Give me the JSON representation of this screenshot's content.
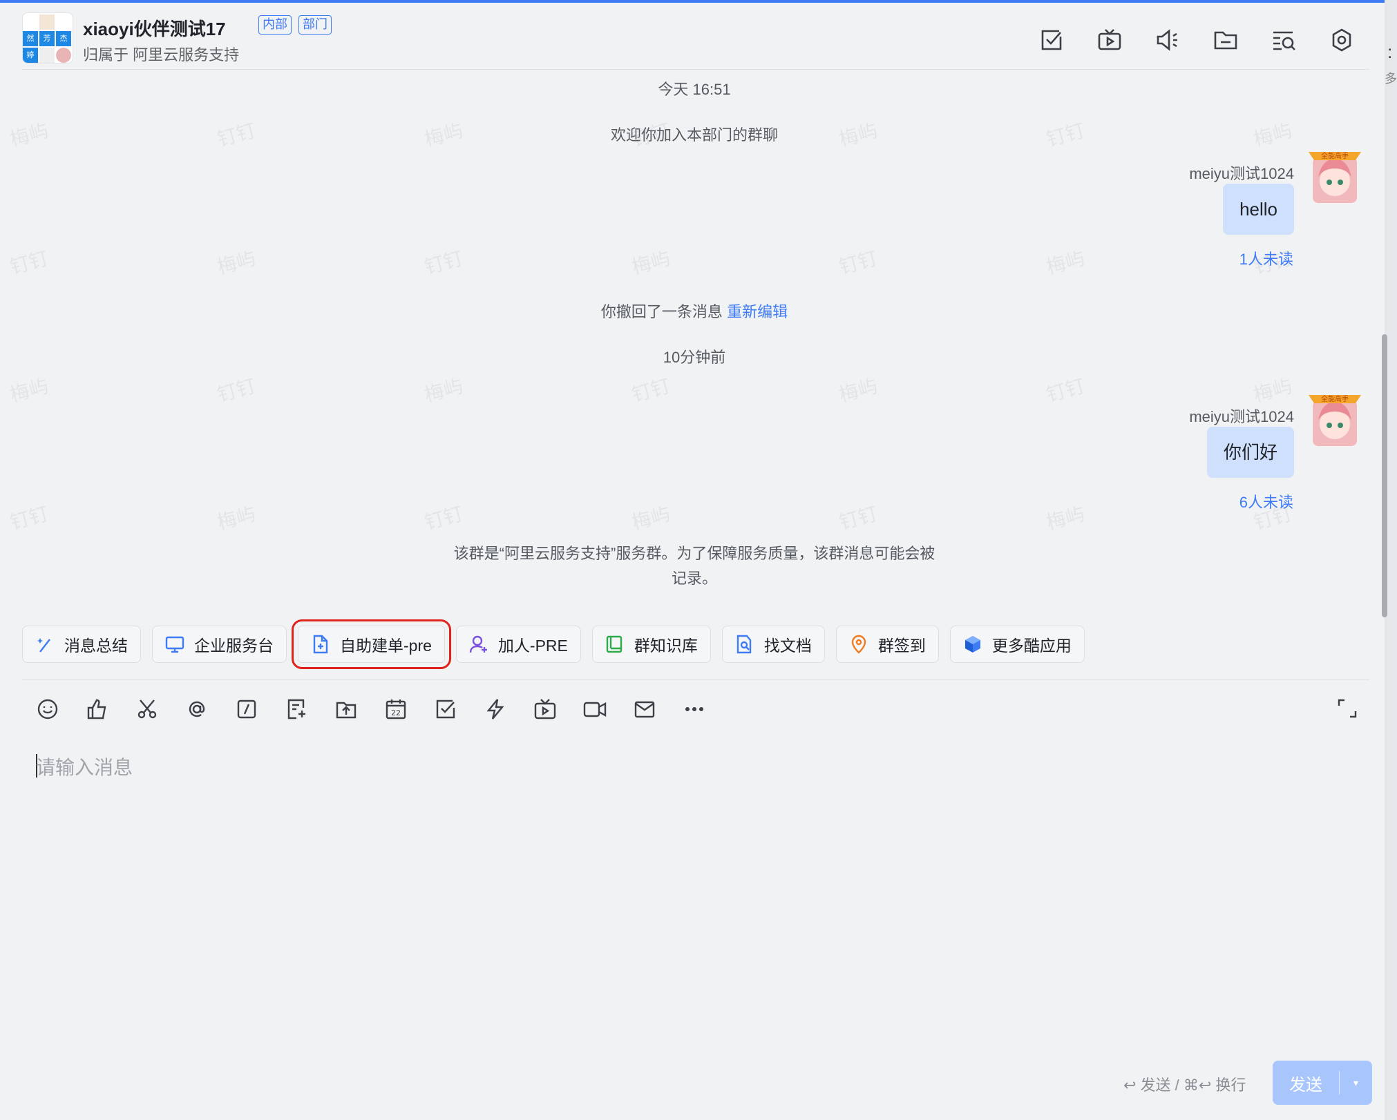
{
  "header": {
    "title": "xiaoyi伙伴测试17",
    "tags": [
      "内部",
      "部门"
    ],
    "subtitle": "归属于 阿里云服务支持",
    "avatar_cells": [
      "然",
      "芳",
      "杰",
      "婷"
    ],
    "icons": [
      "task-check-icon",
      "live-tv-icon",
      "announcement-icon",
      "folder-icon",
      "search-history-icon",
      "settings-icon"
    ]
  },
  "messages": {
    "time1": "今天 16:51",
    "welcome": "欢迎你加入本部门的群聊",
    "msg1": {
      "sender": "meiyu测试1024",
      "text": "hello",
      "status": "1人未读"
    },
    "recall": "你撤回了一条消息",
    "recall_link": "重新编辑",
    "time2": "10分钟前",
    "msg2": {
      "sender": "meiyu测试1024",
      "text": "你们好",
      "status": "6人未读"
    },
    "notice_line1": "该群是“阿里云服务支持”服务群。为了保障服务质量，该群消息可能会被",
    "notice_line2": "记录。",
    "avatar_badge": "全能高手"
  },
  "watermarks": [
    "梅屿",
    "钉钉"
  ],
  "apps": [
    {
      "label": "消息总结",
      "icon": "sparkle-pen-icon",
      "color": "#3e7bf5"
    },
    {
      "label": "企业服务台",
      "icon": "monitor-chat-icon",
      "color": "#3e7bf5"
    },
    {
      "label": "自助建单-pre",
      "icon": "doc-add-icon",
      "color": "#3e7bf5"
    },
    {
      "label": "加人-PRE",
      "icon": "add-user-icon",
      "color": "#7b52e0"
    },
    {
      "label": "群知识库",
      "icon": "knowledge-book-icon",
      "color": "#2eaa4a"
    },
    {
      "label": "找文档",
      "icon": "doc-search-icon",
      "color": "#3e7bf5"
    },
    {
      "label": "群签到",
      "icon": "location-pin-icon",
      "color": "#f07b20"
    },
    {
      "label": "更多酷应用",
      "icon": "cube-icon",
      "color": "#3e7bf5"
    }
  ],
  "toolbar": [
    "emoji-icon",
    "thumbs-up-icon",
    "scissors-icon",
    "at-icon",
    "slash-command-icon",
    "note-add-icon",
    "upload-icon",
    "calendar-icon",
    "task-icon",
    "lightning-icon",
    "live-icon",
    "video-call-icon",
    "mail-icon",
    "more-icon"
  ],
  "calendar_day": "22",
  "composer": {
    "placeholder": "请输入消息",
    "hint": "↩ 发送 / ⌘↩ 换行",
    "send_label": "发送",
    "send_arrow": "▾"
  },
  "right_strip": {
    "text": ":",
    "sub": "多"
  }
}
